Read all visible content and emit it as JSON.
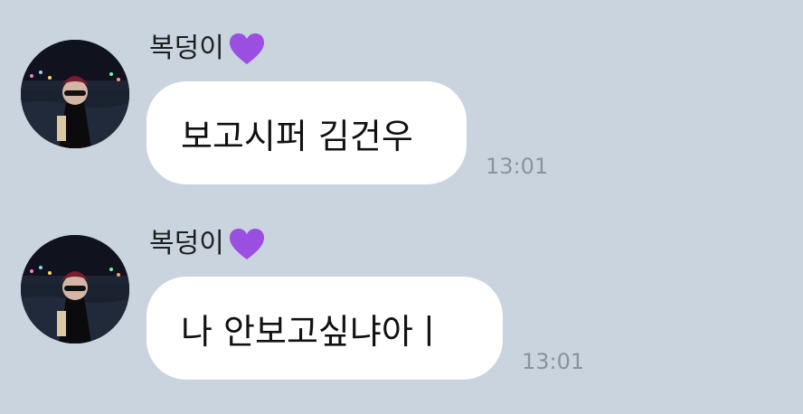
{
  "conversation": {
    "messages": [
      {
        "sender": "복덩이",
        "sender_emoji_icon": "purple-heart-icon",
        "text": "보고시퍼 김건우",
        "time": "13:01"
      },
      {
        "sender": "복덩이",
        "sender_emoji_icon": "purple-heart-icon",
        "text": "나 안보고싶냐아ㅣ",
        "time": "13:01"
      }
    ]
  },
  "colors": {
    "background": "#c9d4de",
    "bubble": "#ffffff",
    "timestamp": "#8a949c",
    "heart": "#9b4fe0"
  }
}
